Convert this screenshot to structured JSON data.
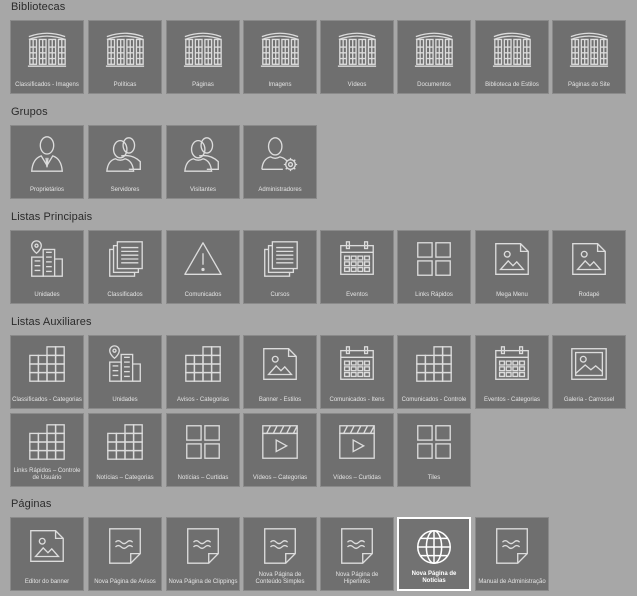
{
  "sections": [
    {
      "title": "Bibliotecas",
      "tiles": [
        {
          "label": "Classificados - Imagens",
          "icon": "library-icon"
        },
        {
          "label": "Políticas",
          "icon": "library-icon"
        },
        {
          "label": "Páginas",
          "icon": "library-icon"
        },
        {
          "label": "Imagens",
          "icon": "library-icon"
        },
        {
          "label": "Vídeos",
          "icon": "library-icon"
        },
        {
          "label": "Documentos",
          "icon": "library-icon"
        },
        {
          "label": "Biblioteca de Estilos",
          "icon": "library-icon"
        },
        {
          "label": "Páginas do Site",
          "icon": "library-icon"
        }
      ]
    },
    {
      "title": "Grupos",
      "tiles": [
        {
          "label": "Proprietários",
          "icon": "owner-user-icon"
        },
        {
          "label": "Servidores",
          "icon": "users-group-icon"
        },
        {
          "label": "Visitantes",
          "icon": "users-group-icon"
        },
        {
          "label": "Administradores",
          "icon": "admin-user-gear-icon"
        }
      ]
    },
    {
      "title": "Listas Principais",
      "tiles": [
        {
          "label": "Unidades",
          "icon": "buildings-pin-icon"
        },
        {
          "label": "Classificados",
          "icon": "documents-stack-icon"
        },
        {
          "label": "Comunicados",
          "icon": "warning-icon"
        },
        {
          "label": "Cursos",
          "icon": "documents-stack-icon"
        },
        {
          "label": "Eventos",
          "icon": "calendar-icon"
        },
        {
          "label": "Links Rápidos",
          "icon": "tiles-grid-icon"
        },
        {
          "label": "Mega Menu",
          "icon": "image-page-icon"
        },
        {
          "label": "Rodapé",
          "icon": "image-page-icon"
        }
      ]
    },
    {
      "title": "Listas Auxiliares",
      "tiles": [
        {
          "label": "Classificados - Categorias",
          "icon": "categories-grid-icon"
        },
        {
          "label": "Unidades",
          "icon": "buildings-pin-icon"
        },
        {
          "label": "Avisos - Categorias",
          "icon": "categories-grid-icon"
        },
        {
          "label": "Banner - Estilos",
          "icon": "image-page-icon"
        },
        {
          "label": "Comunicados - Itens",
          "icon": "calendar-icon"
        },
        {
          "label": "Comunicados - Controle",
          "icon": "categories-grid-icon"
        },
        {
          "label": "Eventos - Categorias",
          "icon": "calendar-icon"
        },
        {
          "label": "Galeria - Carrossel",
          "icon": "picture-frame-icon"
        },
        {
          "label": "Links Rápidos – Controle de Usuário",
          "icon": "categories-grid-icon"
        },
        {
          "label": "Notícias – Categorias",
          "icon": "categories-grid-icon"
        },
        {
          "label": "Notícias – Curtidas",
          "icon": "tiles-grid-icon"
        },
        {
          "label": "Vídeos – Categorias",
          "icon": "video-clapper-icon"
        },
        {
          "label": "Vídeos – Curtidas",
          "icon": "video-clapper-icon"
        },
        {
          "label": "Tiles",
          "icon": "tiles-grid-icon"
        }
      ]
    },
    {
      "title": "Páginas",
      "tiles": [
        {
          "label": "Editor do banner",
          "icon": "image-page-icon"
        },
        {
          "label": "Nova Página de Avisos",
          "icon": "page-icon"
        },
        {
          "label": "Nova Página de Clippings",
          "icon": "page-icon"
        },
        {
          "label": "Nova Página de Conteúdo Simples",
          "icon": "page-icon"
        },
        {
          "label": "Nova Página de Hiperlinks",
          "icon": "page-icon"
        },
        {
          "label": "Nova Página de Notícias",
          "icon": "globe-icon",
          "selected": true
        },
        {
          "label": "Manual de Administração",
          "icon": "page-icon"
        }
      ]
    }
  ]
}
